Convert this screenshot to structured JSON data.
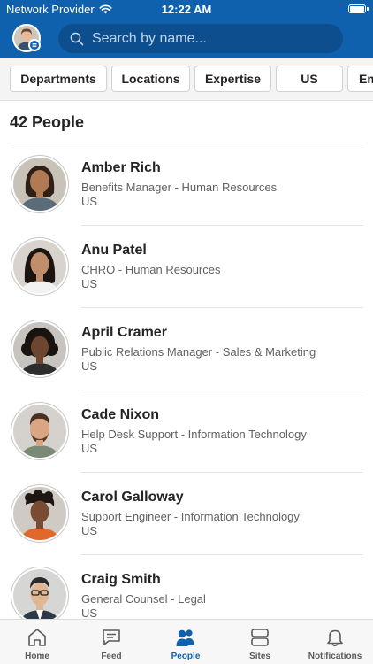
{
  "status_bar": {
    "carrier": "Network Provider",
    "time": "12:22 AM"
  },
  "search": {
    "placeholder": "Search by name..."
  },
  "filters": [
    {
      "label": "Departments"
    },
    {
      "label": "Locations"
    },
    {
      "label": "Expertise"
    },
    {
      "label": "US"
    },
    {
      "label": "Em"
    }
  ],
  "people_count": "42 People",
  "people": [
    {
      "name": "Amber Rich",
      "title": "Benefits Manager - Human Resources",
      "location": "US"
    },
    {
      "name": "Anu Patel",
      "title": "CHRO - Human Resources",
      "location": "US"
    },
    {
      "name": "April Cramer",
      "title": "Public Relations Manager - Sales & Marketing",
      "location": "US"
    },
    {
      "name": "Cade Nixon",
      "title": "Help Desk Support - Information Technology",
      "location": "US"
    },
    {
      "name": "Carol Galloway",
      "title": "Support Engineer - Information Technology",
      "location": "US"
    },
    {
      "name": "Craig Smith",
      "title": "General Counsel - Legal",
      "location": "US"
    }
  ],
  "tabs": [
    {
      "label": "Home",
      "icon": "home-icon"
    },
    {
      "label": "Feed",
      "icon": "feed-icon"
    },
    {
      "label": "People",
      "icon": "people-icon",
      "active": true
    },
    {
      "label": "Sites",
      "icon": "sites-icon"
    },
    {
      "label": "Notifications",
      "icon": "bell-icon"
    }
  ],
  "colors": {
    "brand": "#0f61ad",
    "search_bg": "#0d4f8e",
    "active_tab": "#0f61ad"
  }
}
